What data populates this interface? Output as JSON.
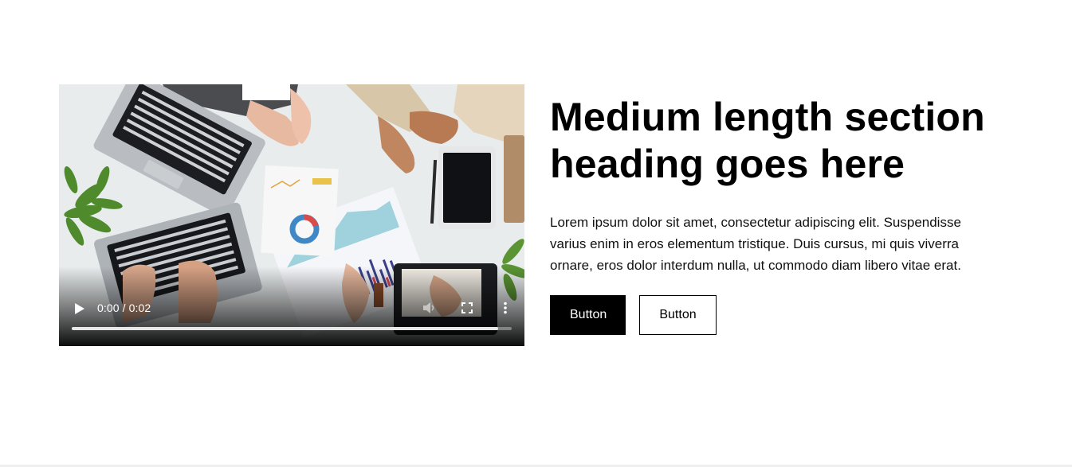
{
  "section": {
    "heading": "Medium length section heading goes here",
    "body": "Lorem ipsum dolor sit amet, consectetur adipiscing elit. Suspendisse varius enim in eros elementum tristique. Duis cursus, mi quis viverra ornare, eros dolor interdum nulla, ut commodo diam libero vitae erat.",
    "primary_button_label": "Button",
    "secondary_button_label": "Button"
  },
  "video": {
    "time_display": "0:00 / 0:02",
    "progress_fraction": 0.97,
    "icons": {
      "play": "play-icon",
      "volume": "volume-icon",
      "fullscreen": "fullscreen-icon",
      "more": "more-vertical-icon"
    }
  },
  "colors": {
    "primary_button_bg": "#000000",
    "primary_button_text": "#ffffff",
    "heading": "#000000",
    "text": "#111111"
  }
}
